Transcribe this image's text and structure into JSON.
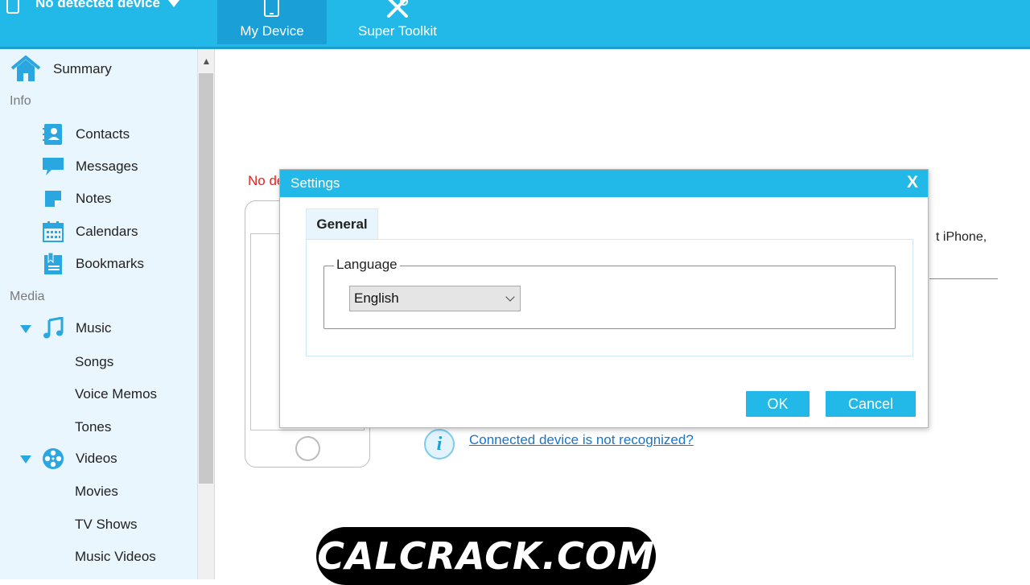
{
  "header": {
    "device_label": "No detected device",
    "tabs": [
      {
        "label": "My Device",
        "active": true
      },
      {
        "label": "Super Toolkit",
        "active": false
      }
    ]
  },
  "sidebar": {
    "summary": "Summary",
    "info_section": "Info",
    "info_items": [
      "Contacts",
      "Messages",
      "Notes",
      "Calendars",
      "Bookmarks"
    ],
    "media_section": "Media",
    "music": "Music",
    "music_items": [
      "Songs",
      "Voice Memos",
      "Tones"
    ],
    "videos": "Videos",
    "video_items": [
      "Movies",
      "TV Shows",
      "Music Videos"
    ]
  },
  "content": {
    "no_device_text": "No de",
    "iphone_text": "t iPhone,",
    "help_link": "Connected device is not recognized?"
  },
  "dialog": {
    "title": "Settings",
    "close_label": "X",
    "tab_label": "General",
    "group_label": "Language",
    "language_value": "English",
    "ok_label": "OK",
    "cancel_label": "Cancel"
  },
  "watermark": "CALCRACK.COM",
  "colors": {
    "accent": "#22b9e8",
    "sidebar_bg": "#eaf6fd",
    "link": "#1a75c9",
    "error": "#e8231e"
  }
}
